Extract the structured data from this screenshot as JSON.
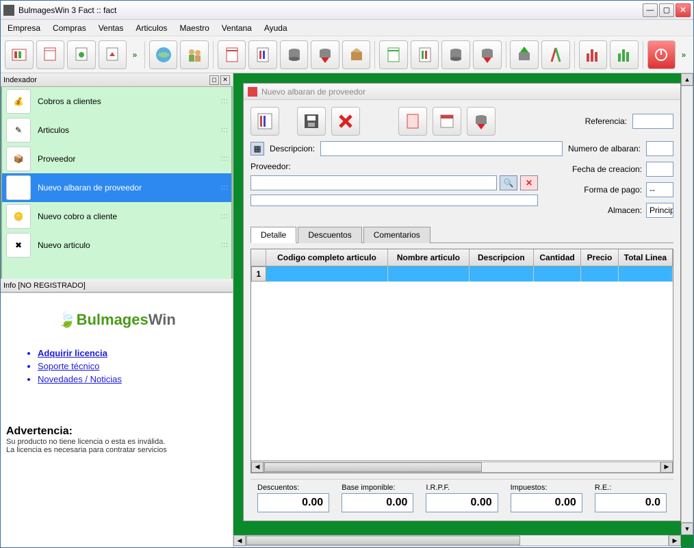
{
  "window": {
    "title": "BulmagesWin 3 Fact :: fact"
  },
  "menu": [
    "Empresa",
    "Compras",
    "Ventas",
    "Articulos",
    "Maestro",
    "Ventana",
    "Ayuda"
  ],
  "dock": {
    "indexer_title": "Indexador",
    "info_title": "Info [NO REGISTRADO]"
  },
  "indexer_items": [
    {
      "label": "Cobros a clientes"
    },
    {
      "label": "Articulos"
    },
    {
      "label": "Proveedor"
    },
    {
      "label": "Nuevo albaran de proveedor",
      "selected": true
    },
    {
      "label": "Nuevo cobro a cliente"
    },
    {
      "label": "Nuevo articulo"
    }
  ],
  "info": {
    "logo1": "Bulmages",
    "logo2": "Win",
    "links": [
      {
        "text": "Adquirir licencia",
        "bold": true
      },
      {
        "text": "Soporte técnico"
      },
      {
        "text": "Novedades / Noticias"
      }
    ],
    "warn_h": "Advertencia:",
    "warn_t1": "Su producto no tiene licencia o esta es inválida.",
    "warn_t2": "La licencia es necesaria para contratar servicios"
  },
  "mdi": {
    "title": "Nuevo albaran de proveedor",
    "labels": {
      "referencia": "Referencia:",
      "descripcion": "Descripcion:",
      "numero_albaran": "Numero de albaran:",
      "proveedor": "Proveedor:",
      "fecha": "Fecha de creacion:",
      "forma_pago": "Forma de pago:",
      "almacen": "Almacen:"
    },
    "values": {
      "forma_pago": "--",
      "almacen": "Princip"
    },
    "tabs": [
      "Detalle",
      "Descuentos",
      "Comentarios"
    ],
    "grid_headers": [
      "",
      "Codigo completo articulo",
      "Nombre articulo",
      "Descripcion",
      "Cantidad",
      "Precio",
      "Total Linea"
    ],
    "grid_rownum": "1",
    "totals": [
      {
        "label": "Descuentos:",
        "value": "0.00"
      },
      {
        "label": "Base imponible:",
        "value": "0.00"
      },
      {
        "label": "I.R.P.F.",
        "value": "0.00"
      },
      {
        "label": "Impuestos:",
        "value": "0.00"
      },
      {
        "label": "R.E.:",
        "value": "0.0"
      }
    ]
  }
}
